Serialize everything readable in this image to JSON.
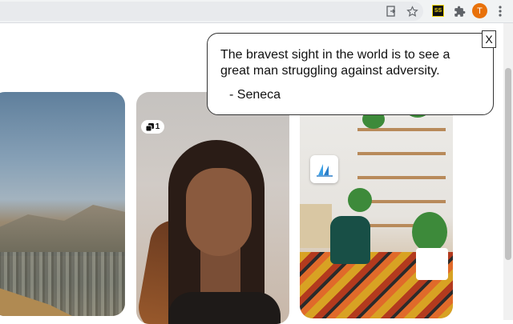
{
  "browser": {
    "toolbar_icons": [
      "page-action-icon",
      "bookmark-star-icon",
      "extension-icon",
      "puzzle-icon",
      "menu-icon"
    ],
    "extension_badge": "SS",
    "profile_initial": "T",
    "profile_color": "#e8710a"
  },
  "pins": [
    {
      "description": "mountain-town-photo"
    },
    {
      "description": "portrait-photo",
      "badge_count": "1"
    },
    {
      "description": "plant-shelf-interior-photo"
    }
  ],
  "quote": {
    "text": "The bravest sight in the world is to see a great man struggling against adversity.",
    "author": "- Seneca",
    "close_label": "X"
  }
}
